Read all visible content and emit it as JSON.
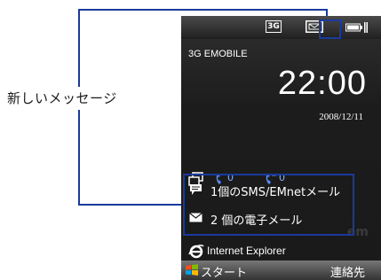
{
  "annotation": {
    "label": "新しいメッセージ"
  },
  "status_bar": {
    "network": "3G"
  },
  "today": {
    "carrier": "3G EMOBILE",
    "time": "22:00",
    "date": "2008/12/11"
  },
  "indicators": {
    "missed_calls": "0",
    "voicemail": "0"
  },
  "notifications": [
    {
      "label": "1個のSMS/EMnetメール",
      "icon": "sms-icon"
    },
    {
      "label": "2 個の電子メール",
      "icon": "envelope-icon"
    }
  ],
  "browser": {
    "label": "Internet Explorer"
  },
  "softkeys": {
    "left": "スタート",
    "right": "連絡先"
  },
  "colors": {
    "annotation": "#1a3a9c",
    "screen_bg": "#1c1c1c",
    "accent_blue": "#8ab4ff"
  }
}
